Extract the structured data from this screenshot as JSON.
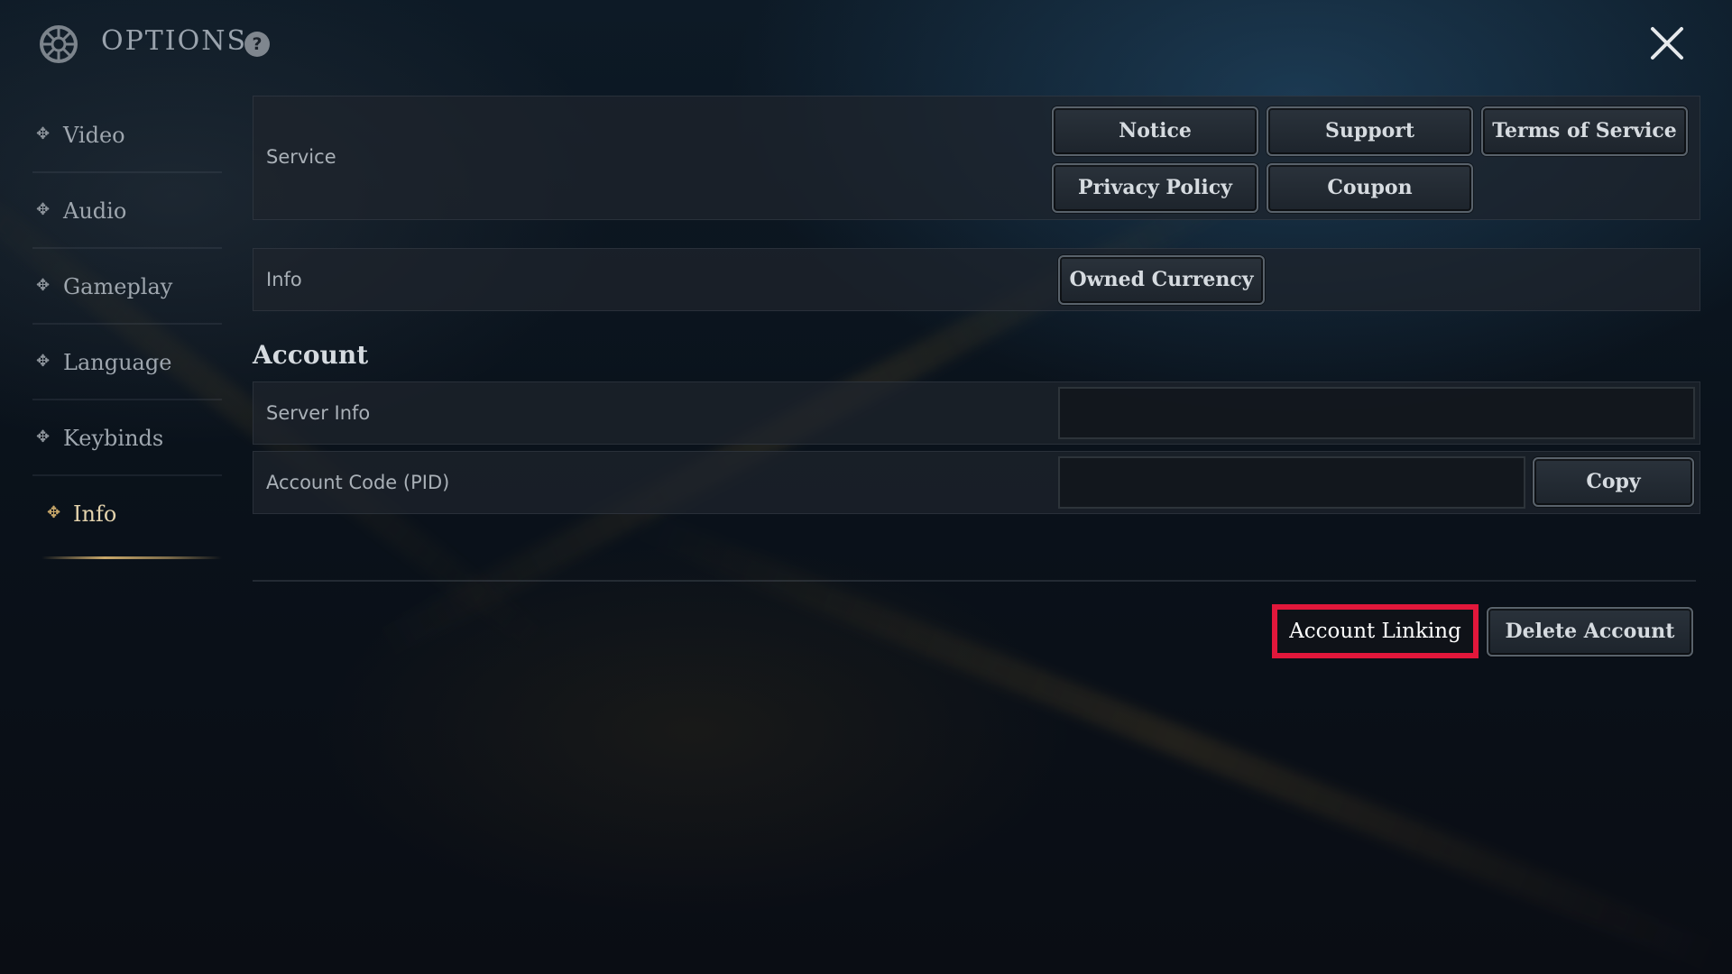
{
  "header": {
    "title": "OPTIONS",
    "help_glyph": "?",
    "gear_icon": "gear-icon",
    "close_icon": "close-icon"
  },
  "sidebar": {
    "items": [
      {
        "label": "Video",
        "active": false
      },
      {
        "label": "Audio",
        "active": false
      },
      {
        "label": "Gameplay",
        "active": false
      },
      {
        "label": "Language",
        "active": false
      },
      {
        "label": "Keybinds",
        "active": false
      },
      {
        "label": "Info",
        "active": true
      }
    ]
  },
  "service": {
    "label": "Service",
    "buttons": [
      "Notice",
      "Support",
      "Terms of Service",
      "Privacy Policy",
      "Coupon"
    ]
  },
  "info": {
    "label": "Info",
    "owned_currency": "Owned Currency"
  },
  "account": {
    "title": "Account",
    "server_info_label": "Server Info",
    "server_info_value": "",
    "account_code_label": "Account Code (PID)",
    "account_code_value": "",
    "copy": "Copy",
    "account_linking": "Account Linking",
    "delete_account": "Delete Account"
  },
  "colors": {
    "accent_gold": "#c9a86a",
    "highlight_red": "#e2173b"
  }
}
